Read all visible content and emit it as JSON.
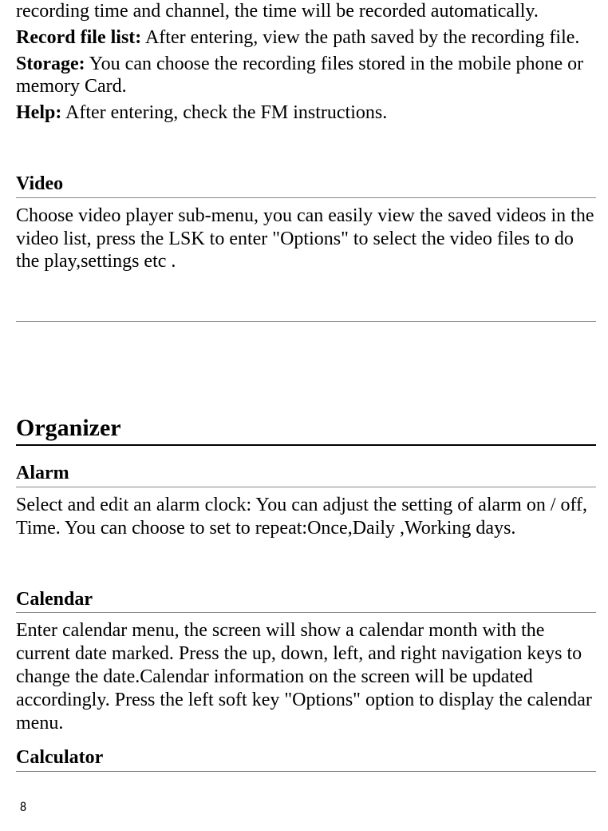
{
  "intro": {
    "line1": "recording time and channel, the time will be recorded automatically.",
    "record_file_list_label": "Record file list:",
    "record_file_list_text": "   After entering, view the path saved by the recording file.",
    "storage_label": "Storage:",
    "storage_text": "   You can choose the recording files stored in the mobile phone or memory Card.",
    "help_label": "Help:",
    "help_text": "   After entering, check the FM instructions."
  },
  "video": {
    "heading": "Video",
    "body": "Choose video player sub-menu, you can easily view the saved videos in the video list, press the LSK to enter \"Options\" to select the video files to do the play,settings etc ."
  },
  "organizer": {
    "heading": "Organizer",
    "alarm": {
      "heading": "Alarm",
      "body": "Select and edit an alarm clock: You can adjust the setting of alarm on / off, Time. You can choose to set to repeat:Once,Daily ,Working days."
    },
    "calendar": {
      "heading": "Calendar",
      "body": "Enter calendar menu, the screen will show a calendar month with the current date marked. Press the up, down, left, and right navigation keys to change the date.Calendar information on the screen will be updated accordingly. Press the left soft key \"Options\" option to display the calendar menu."
    },
    "calculator": {
      "heading": "Calculator"
    }
  },
  "page_number": "8"
}
